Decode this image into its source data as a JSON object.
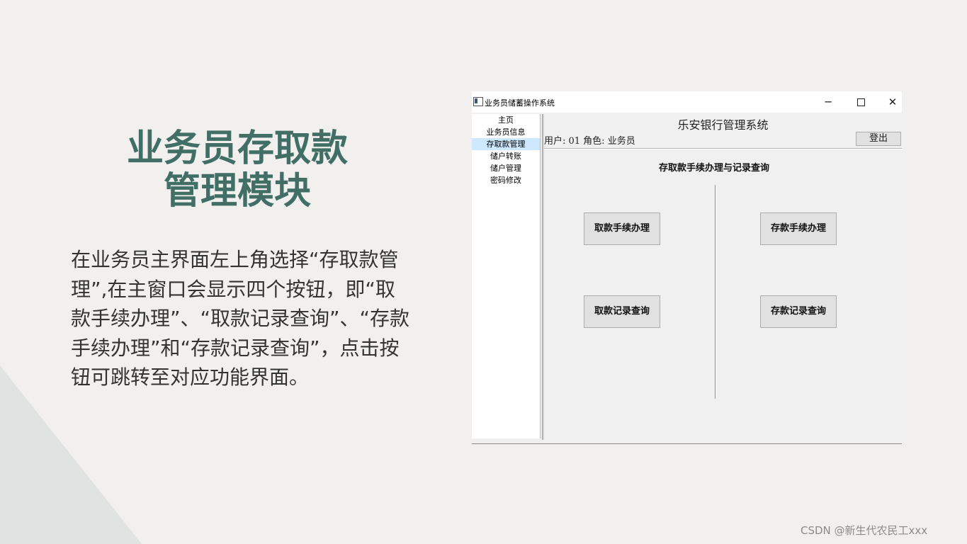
{
  "slide": {
    "title_line1": "业务员存取款",
    "title_line2": "管理模块",
    "description": "在业务员主界面左上角选择“存取款管理”,在主窗口会显示四个按钮，即“取款手续办理”、“取款记录查询”、“存款手续办理”和“存款记录查询”，点击按钮可跳转至对应功能界面。",
    "title_color": "#416f66"
  },
  "window": {
    "title": "业务员储蓄操作系统",
    "controls": {
      "minimize": "─",
      "maximize": "",
      "close": "✕"
    },
    "icon": "app-icon"
  },
  "sidebar": {
    "items": [
      {
        "label": "主页"
      },
      {
        "label": "业务员信息"
      },
      {
        "label": "存取款管理",
        "selected": true
      },
      {
        "label": "储户转账"
      },
      {
        "label": "储户管理"
      },
      {
        "label": "密码修改"
      }
    ],
    "selected_color": "#cde8ff"
  },
  "main": {
    "system_title": "乐安银行管理系统",
    "user_info": "用户: 01 角色: 业务员",
    "logout_label": "登出",
    "section_title": "存取款手续办理与记录查询",
    "buttons": {
      "withdraw_process": "取款手续办理",
      "deposit_process": "存款手续办理",
      "withdraw_records": "取款记录查询",
      "deposit_records": "存款记录查询"
    }
  },
  "watermark": "CSDN @新生代农民工xxx"
}
